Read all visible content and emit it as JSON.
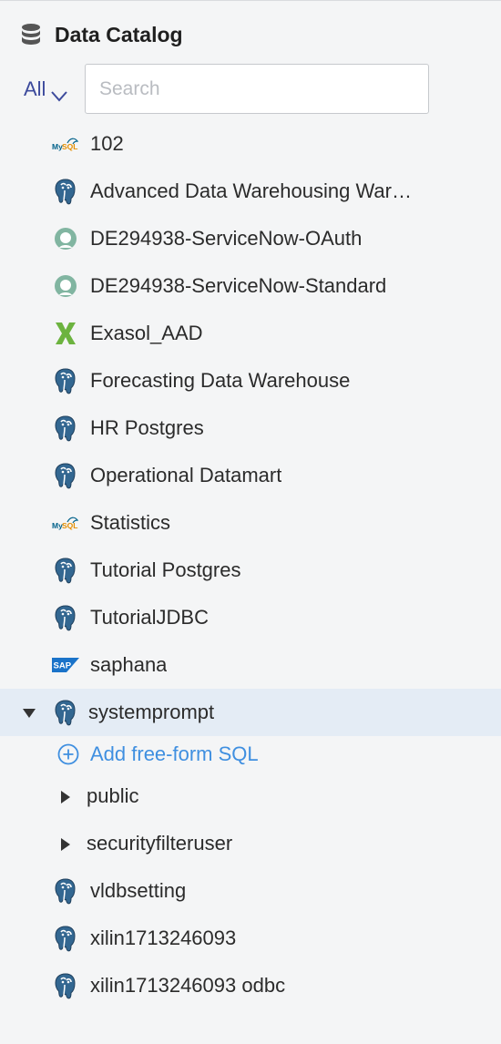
{
  "header": {
    "title": "Data Catalog",
    "icon": "database-icon"
  },
  "filter": {
    "scope_label": "All",
    "search_placeholder": "Search",
    "search_value": ""
  },
  "colors": {
    "accent": "#3f8fe0",
    "scope": "#3c4a9c",
    "selected_bg": "#e4ecf5",
    "postgres": "#336791",
    "exasol": "#6cb33f"
  },
  "items": [
    {
      "label": "102",
      "icon": "mysql-icon"
    },
    {
      "label": "Advanced Data Warehousing War…",
      "icon": "postgres-icon"
    },
    {
      "label": "DE294938-ServiceNow-OAuth",
      "icon": "servicenow-icon"
    },
    {
      "label": "DE294938-ServiceNow-Standard",
      "icon": "servicenow-icon"
    },
    {
      "label": "Exasol_AAD",
      "icon": "exasol-icon"
    },
    {
      "label": "Forecasting Data Warehouse",
      "icon": "postgres-icon"
    },
    {
      "label": "HR Postgres",
      "icon": "postgres-icon"
    },
    {
      "label": "Operational Datamart",
      "icon": "postgres-icon"
    },
    {
      "label": "Statistics",
      "icon": "mysql-icon"
    },
    {
      "label": "Tutorial Postgres",
      "icon": "postgres-icon"
    },
    {
      "label": "TutorialJDBC",
      "icon": "postgres-icon"
    },
    {
      "label": "saphana",
      "icon": "sap-icon"
    },
    {
      "label": "systemprompt",
      "icon": "postgres-icon",
      "expanded": true,
      "selected": true
    },
    {
      "label": "vldbsetting",
      "icon": "postgres-icon"
    },
    {
      "label": "xilin1713246093",
      "icon": "postgres-icon"
    },
    {
      "label": "xilin1713246093 odbc",
      "icon": "postgres-icon"
    }
  ],
  "expanded": {
    "add_sql_label": "Add free-form SQL",
    "schemas": [
      {
        "label": "public"
      },
      {
        "label": "securityfilteruser"
      }
    ]
  }
}
